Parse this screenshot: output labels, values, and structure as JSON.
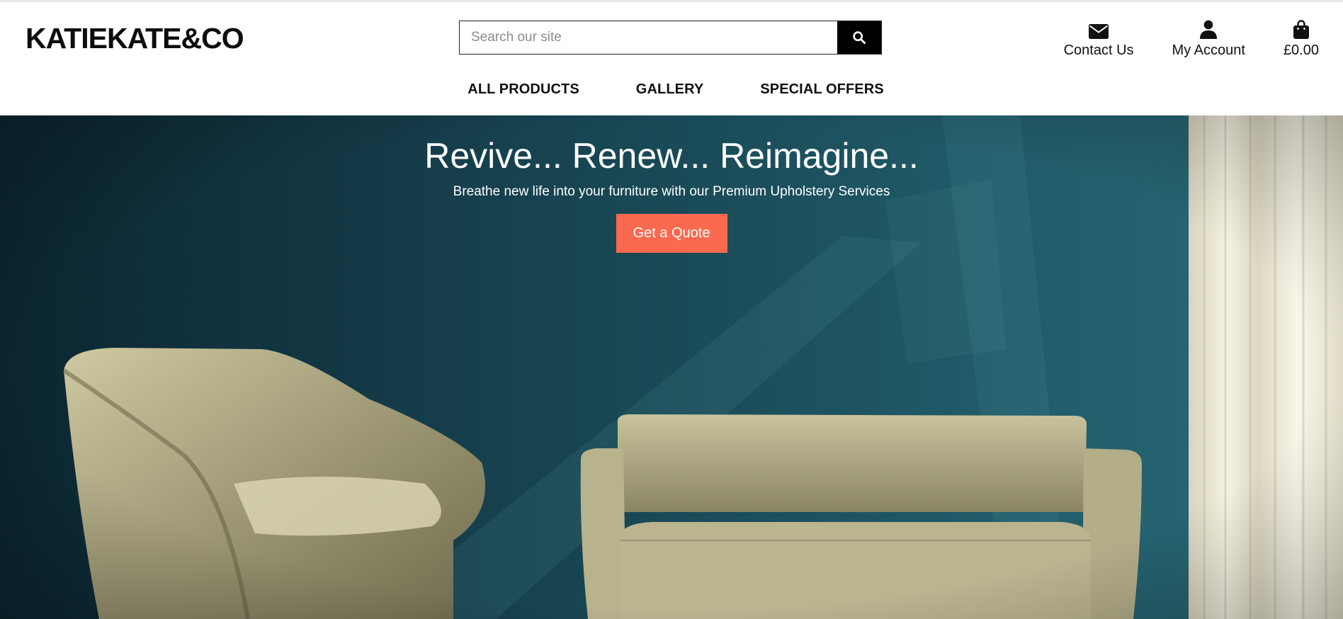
{
  "brand": {
    "logo_text": "KATIEKATE&CO"
  },
  "search": {
    "placeholder": "Search our site",
    "value": "",
    "button_icon": "search-icon"
  },
  "account_nav": [
    {
      "label": "Contact Us",
      "icon": "envelope-icon"
    },
    {
      "label": "My Account",
      "icon": "user-icon"
    },
    {
      "label": "£0.00",
      "icon": "shopping-bag-icon"
    }
  ],
  "main_nav": [
    {
      "label": "ALL PRODUCTS"
    },
    {
      "label": "GALLERY"
    },
    {
      "label": "SPECIAL OFFERS"
    }
  ],
  "hero": {
    "title": "Revive... Renew... Reimagine...",
    "subtitle": "Breathe new life into your furniture with our Premium Upholstery Services",
    "cta_label": "Get a Quote"
  },
  "colors": {
    "cta_background": "#fb6a4f",
    "hero_wall": "#1d4a58",
    "search_button": "#000000"
  }
}
